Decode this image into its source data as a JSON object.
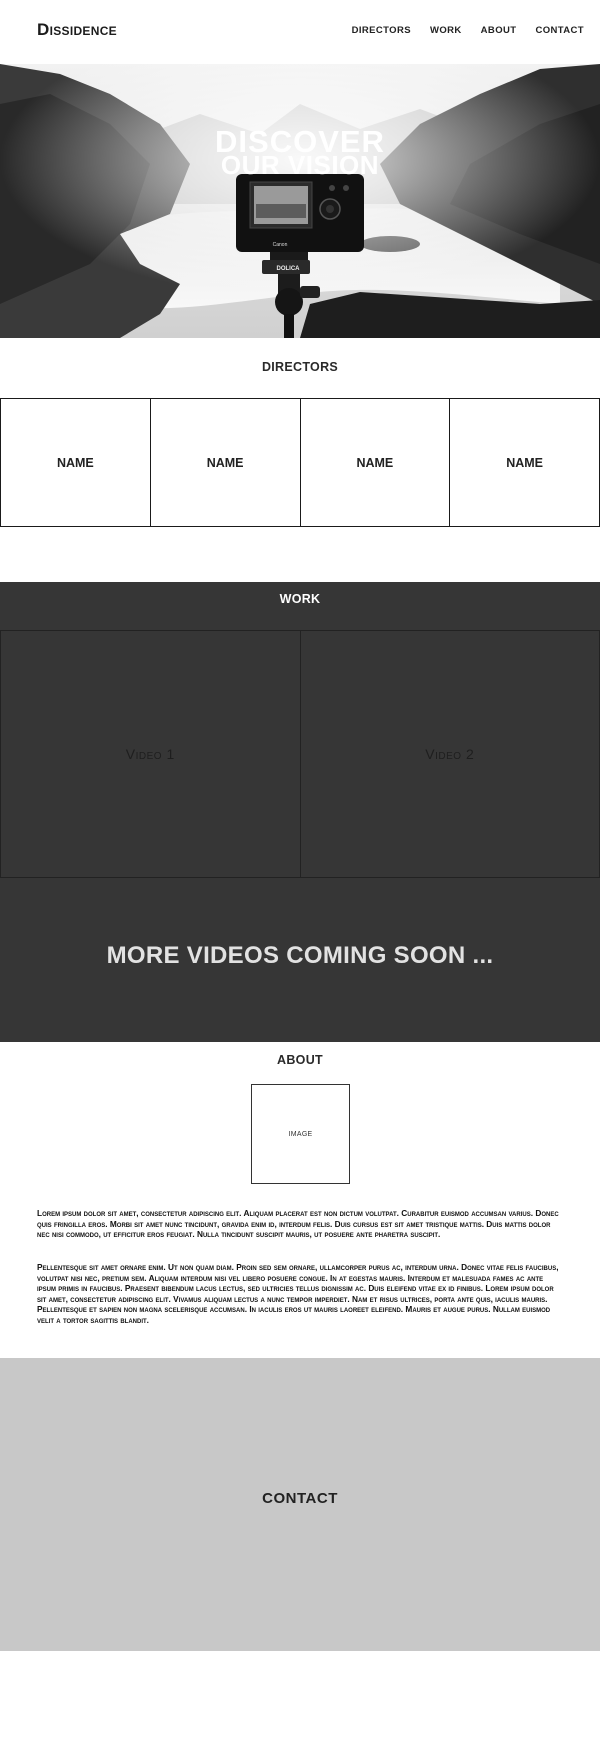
{
  "nav": {
    "logo": "Dissidence",
    "links": [
      "DIRECTORS",
      "WORK",
      "ABOUT",
      "CONTACT"
    ]
  },
  "hero": {
    "line1": "DISCOVER",
    "line2": "OUR VISION",
    "camera_brand": "Canon",
    "tripod_label": "DOLICA"
  },
  "directors": {
    "heading": "DIRECTORS",
    "cards": [
      "NAME",
      "NAME",
      "NAME",
      "NAME"
    ]
  },
  "work": {
    "heading": "WORK",
    "videos": [
      "Video 1",
      "Video 2"
    ],
    "coming_soon": "MORE VIDEOS COMING SOON ..."
  },
  "about": {
    "heading": "ABOUT",
    "image_label": "IMAGE",
    "paragraph1": "Lorem ipsum dolor sit amet, consectetur adipiscing elit. Aliquam placerat est non dictum volutpat. Curabitur euismod accumsan varius. Donec quis fringilla eros. Morbi sit amet nunc tincidunt, gravida enim id, interdum felis. Duis cursus est sit amet tristique mattis. Duis mattis dolor nec nisi commodo, ut efficitur eros feugiat. Nulla tincidunt suscipit mauris, ut posuere ante pharetra suscipit.",
    "paragraph2": "Pellentesque sit amet ornare enim. Ut non quam diam. Proin sed sem ornare, ullamcorper purus ac, interdum urna. Donec vitae felis faucibus, volutpat nisi nec, pretium sem. Aliquam interdum nisi vel libero posuere congue. In at egestas mauris. Interdum et malesuada fames ac ante ipsum primis in faucibus. Praesent bibendum lacus lectus, sed ultricies tellus dignissim ac. Duis eleifend vitae ex id finibus. Lorem ipsum dolor sit amet, consectetur adipiscing elit. Vivamus aliquam lectus a nunc tempor imperdiet. Nam et risus ultrices, porta ante quis, iaculis mauris. Pellentesque et sapien non magna scelerisque accumsan. In iaculis eros ut mauris laoreet eleifend. Mauris et augue purus. Nullam euismod velit a tortor sagittis blandit."
  },
  "contact": {
    "heading": "CONTACT",
    "background_color": "#c8c8c8"
  },
  "colors": {
    "work_background": "#363636",
    "text_dark": "#222222"
  }
}
